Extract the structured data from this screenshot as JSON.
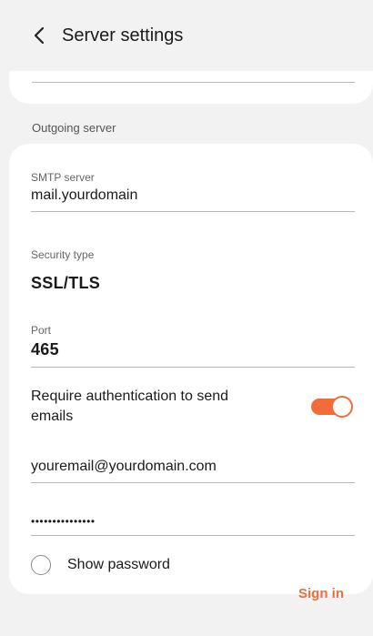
{
  "header": {
    "title": "Server settings",
    "back_icon": "chevron-left-icon"
  },
  "outgoing": {
    "section_label": "Outgoing server",
    "smtp_label": "SMTP server",
    "smtp_value": "mail.yourdomain",
    "security_label": "Security type",
    "security_value": "SSL/TLS",
    "port_label": "Port",
    "port_value": "465",
    "auth_label": "Require authentication to send emails",
    "auth_enabled": true,
    "email_value": "youremail@yourdomain.com",
    "password_value": "•••••••••••••••",
    "show_password_label": "Show password",
    "show_password_checked": false
  },
  "footer": {
    "signin_label": "Sign in"
  },
  "colors": {
    "accent": "#f26c3b",
    "background": "#f2f2f2",
    "card": "#ffffff"
  }
}
